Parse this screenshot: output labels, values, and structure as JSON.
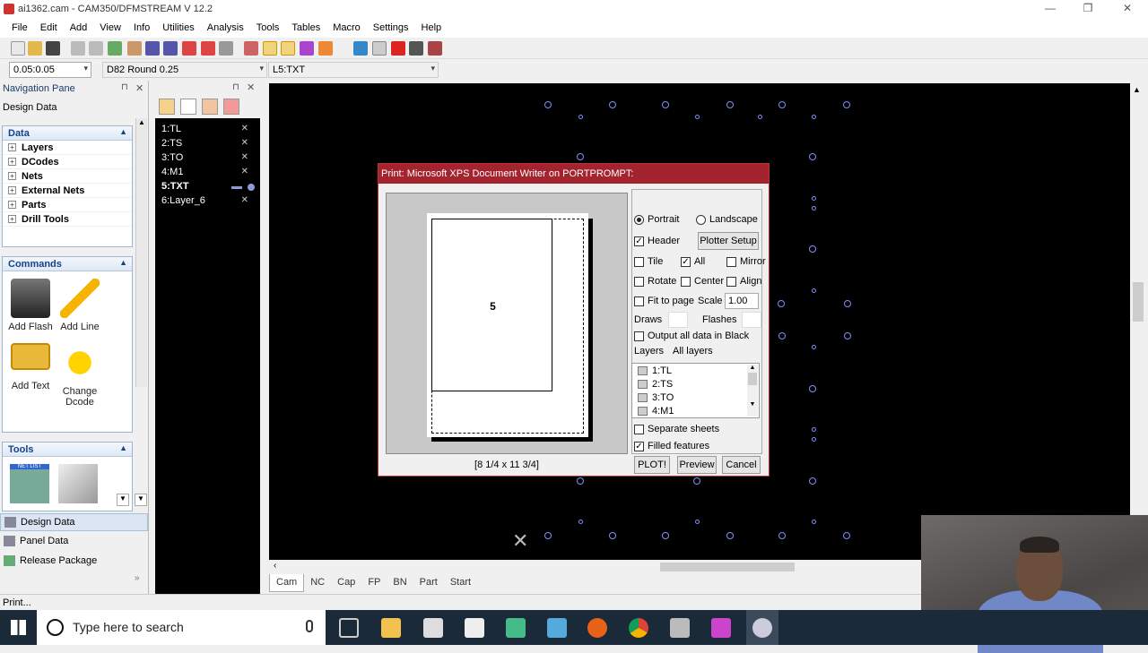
{
  "window": {
    "title": "ai1362.cam - CAM350/DFMSTREAM V 12.2"
  },
  "menu": [
    "File",
    "Edit",
    "Add",
    "View",
    "Info",
    "Utilities",
    "Analysis",
    "Tools",
    "Tables",
    "Macro",
    "Settings",
    "Help"
  ],
  "toolbar2": {
    "grid_value": "0.05:0.05",
    "dcode_value": "D82  Round 0.25",
    "layer_value": "L5:TXT"
  },
  "nav": {
    "title": "Navigation Pane",
    "subtitle": "Design Data",
    "data_group": "Data",
    "tree": [
      "Layers",
      "DCodes",
      "Nets",
      "External Nets",
      "Parts",
      "Drill Tools"
    ],
    "commands_group": "Commands",
    "commands": [
      "Add Flash",
      "Add Line",
      "Add Text",
      "Change Dcode"
    ],
    "tools_group": "Tools",
    "tool_icon_label": "NET LIST",
    "bottom": [
      "Design Data",
      "Panel Data",
      "Release Package"
    ]
  },
  "layers": [
    {
      "label": "1:TL",
      "active": false
    },
    {
      "label": "2:TS",
      "active": false
    },
    {
      "label": "3:TO",
      "active": false
    },
    {
      "label": "4:M1",
      "active": false
    },
    {
      "label": "5:TXT",
      "active": true
    },
    {
      "label": "6:Layer_6",
      "active": false
    }
  ],
  "tabs": [
    "Cam",
    "NC",
    "Cap",
    "FP",
    "BN",
    "Part",
    "Start"
  ],
  "status": "Print...",
  "taskbar": {
    "search_placeholder": "Type here to search"
  },
  "dialog": {
    "title": "Print: Microsoft XPS Document Writer on PORTPROMPT:",
    "page_number": "5",
    "page_size": "[8 1/4 x 11 3/4]",
    "portrait": "Portrait",
    "landscape": "Landscape",
    "header": "Header",
    "plotter_setup": "Plotter Setup",
    "tile": "Tile",
    "all": "All",
    "mirror": "Mirror",
    "rotate": "Rotate",
    "center": "Center",
    "align": "Align",
    "fit_to_page": "Fit to page",
    "scale_label": "Scale",
    "scale_value": "1.00",
    "draws": "Draws",
    "flashes": "Flashes",
    "output_black": "Output all data in Black",
    "layers_label": "Layers",
    "all_layers": "All layers",
    "layer_list": [
      "1:TL",
      "2:TS",
      "3:TO",
      "4:M1"
    ],
    "separate_sheets": "Separate sheets",
    "filled_features": "Filled features",
    "plot": "PLOT!",
    "preview": "Preview",
    "cancel": "Cancel"
  },
  "colors": {
    "dialog_title": "#a3232f",
    "pad_stroke": "#7f8fff",
    "canvas": "#000000"
  }
}
